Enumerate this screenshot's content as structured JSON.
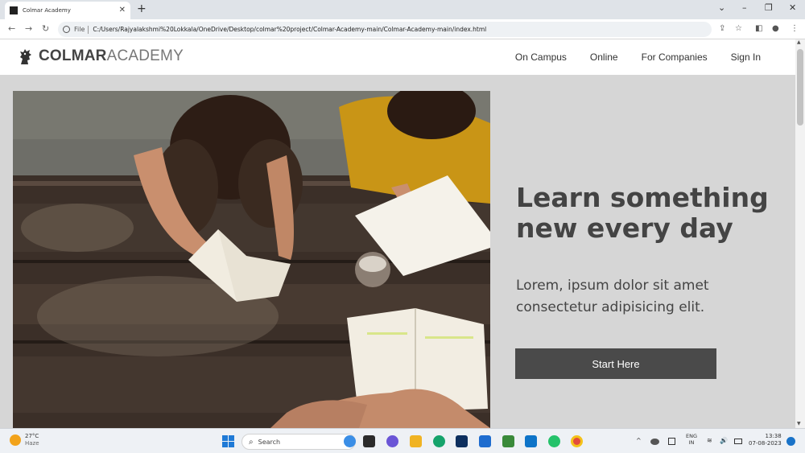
{
  "browser": {
    "tab_title": "Colmar Academy",
    "tab_close": "✕",
    "new_tab": "+",
    "url_scheme_label": "File",
    "url": "C:/Users/Rajyalakshmi%20Lokkala/OneDrive/Desktop/colmar%20project/Colmar-Academy-main/Colmar-Academy-main/index.html",
    "window_controls": {
      "dropdown": "⌄",
      "minimize": "–",
      "maximize": "❐",
      "close": "✕"
    },
    "nav": {
      "back": "←",
      "forward": "→",
      "reload": "↻"
    },
    "address_right": {
      "share": "⇪",
      "star": "☆",
      "panel": "◧",
      "profile": "●",
      "menu": "⋮"
    }
  },
  "site": {
    "logo_bold": "COLMAR",
    "logo_light": "ACADEMY",
    "nav": [
      {
        "label": "On Campus"
      },
      {
        "label": "Online"
      },
      {
        "label": "For Companies"
      },
      {
        "label": "Sign In"
      }
    ],
    "hero": {
      "title": "Learn something new every day",
      "subtitle": "Lorem, ipsum dolor sit amet consectetur adipisicing elit.",
      "cta": "Start Here"
    }
  },
  "taskbar": {
    "weather_temp": "27°C",
    "weather_cond": "Haze",
    "search_placeholder": "Search",
    "lang_top": "ENG",
    "lang_bottom": "IN",
    "time": "13:38",
    "date": "07-08-2023",
    "tray_up": "^",
    "tray_sound": "🔊",
    "tray_wifi": "≋"
  },
  "colors": {
    "page_bg": "#d6d6d6",
    "navbar_bg": "#ffffff",
    "cta_bg": "#4a4a4a",
    "text_dark": "#444444"
  }
}
